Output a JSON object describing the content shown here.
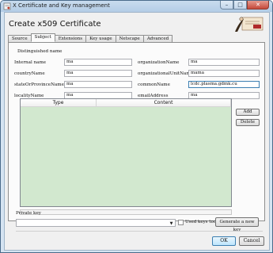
{
  "window": {
    "title": "X Certificate and Key management",
    "minimize_glyph": "–",
    "maximize_glyph": "□",
    "close_glyph": "✕"
  },
  "header": {
    "title": "Create x509 Certificate"
  },
  "tabs": [
    {
      "label": "Source",
      "active": false
    },
    {
      "label": "Subject",
      "active": true
    },
    {
      "label": "Extensions",
      "active": false
    },
    {
      "label": "Key usage",
      "active": false
    },
    {
      "label": "Netscape",
      "active": false
    },
    {
      "label": "Advanced",
      "active": false
    }
  ],
  "subject": {
    "group_title": "Distinguished name",
    "fields": [
      {
        "label": "Internal name",
        "value": "ma"
      },
      {
        "label": "countryName",
        "value": "ma"
      },
      {
        "label": "stateOrProvinceName",
        "value": "ma"
      },
      {
        "label": "localityName",
        "value": "ma"
      },
      {
        "label": "organizationName",
        "value": "ma"
      },
      {
        "label": "organizationalUnitName",
        "value": "mama"
      },
      {
        "label": "commonName",
        "value": "lcdc.plasma.gdmk.cu"
      },
      {
        "label": "emailAddress",
        "value": "ma"
      }
    ]
  },
  "extensions_table": {
    "columns": [
      "Type",
      "Content"
    ],
    "add_label": "Add",
    "delete_label": "Delete"
  },
  "private_key": {
    "label": "Private key",
    "selected": "",
    "used_keys_label": "Used keys too",
    "used_keys_checked": false,
    "generate_label": "Generate a new key"
  },
  "footer": {
    "ok_label": "OK",
    "cancel_label": "Cancel"
  },
  "colors": {
    "table_background": "#d2e8cf",
    "window_frame": "#b3cce6"
  }
}
